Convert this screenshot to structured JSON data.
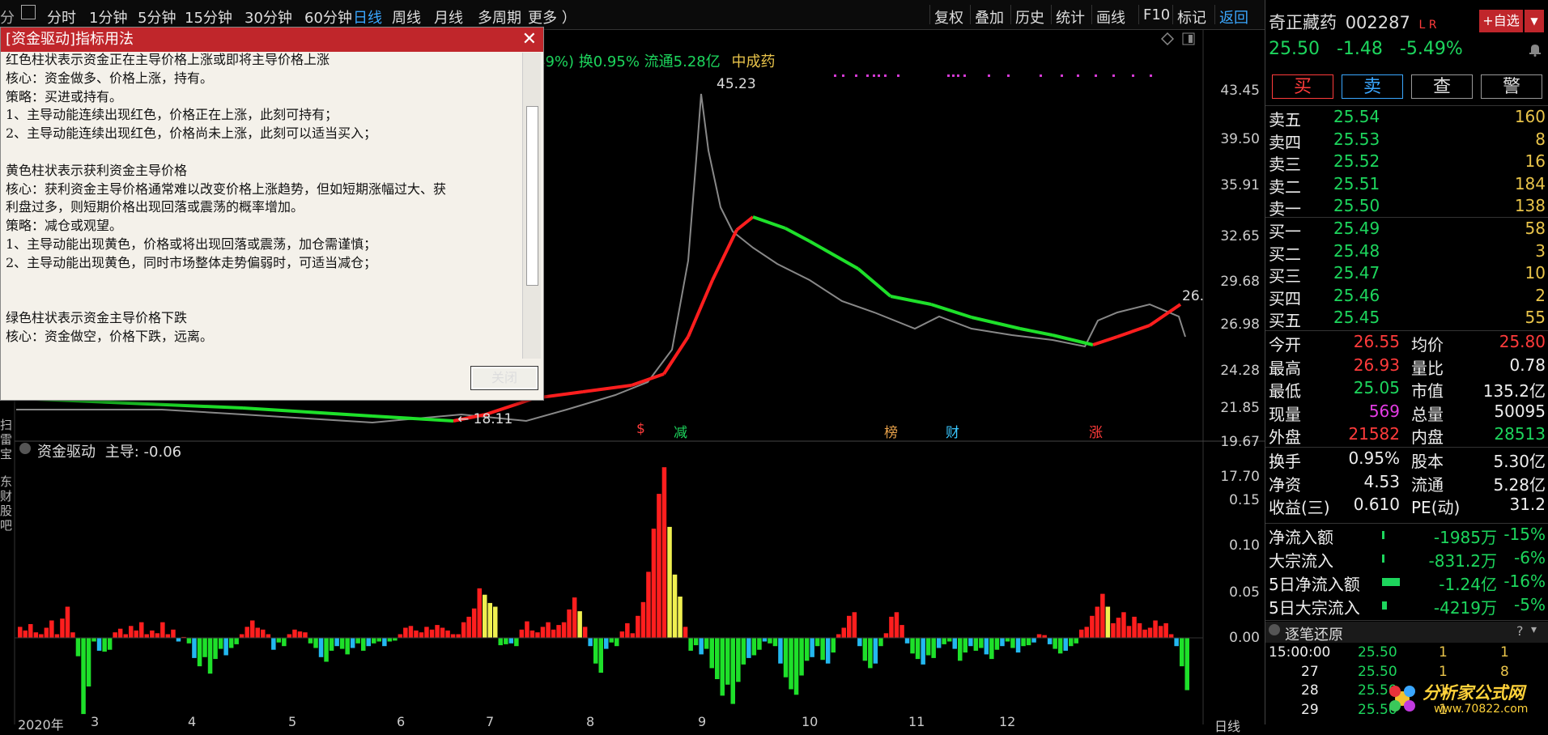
{
  "toolbar": {
    "left_stub": "分",
    "periods": [
      "分时",
      "1分钟",
      "5分钟",
      "15分钟",
      "30分钟",
      "60分钟",
      "日线",
      "周线",
      "月线",
      "多周期",
      "更多 ）"
    ],
    "active_period": "日线",
    "tools": [
      "复权",
      "叠加",
      "历史",
      "统计",
      "画线",
      "F10",
      "标记",
      "返回"
    ]
  },
  "main_chart": {
    "info_text": "49%) 换0.95% 流通5.28亿",
    "sector": "中成药",
    "price_axis": [
      "43.45",
      "39.50",
      "35.91",
      "32.65",
      "29.68",
      "26.98",
      "24.28",
      "21.85",
      "19.67",
      "17.70"
    ],
    "last_price_tag": "26.",
    "high_label": "45.23",
    "low_label": "← 18.11",
    "event_markers": [
      {
        "text": "$",
        "color": "#ff3b3b"
      },
      {
        "text": "减",
        "color": "#1dd65d"
      },
      {
        "text": "榜",
        "color": "#e9a24a"
      },
      {
        "text": "财",
        "color": "#3ac8ff"
      },
      {
        "text": "涨",
        "color": "#ff3b3b"
      }
    ]
  },
  "indicator": {
    "name": "资金驱动",
    "main_label": "主导: -0.06",
    "axis": [
      "0.15",
      "0.10",
      "0.05",
      "0.00"
    ],
    "x_axis": [
      "2020年",
      "3",
      "4",
      "5",
      "6",
      "7",
      "8",
      "9",
      "10",
      "11",
      "12"
    ],
    "period_label": "日线"
  },
  "left_vertical": {
    "text1": "扫雷宝",
    "text2": "东财股吧"
  },
  "dialog": {
    "title": "[资金驱动]指标用法",
    "lines": [
      "红色柱状表示资金正在主导价格上涨或即将主导价格上涨",
      "  核心：资金做多、价格上涨，持有。",
      "  策略：买进或持有。",
      "1、主导动能连续出现红色，价格正在上涨，此刻可持有；",
      "2、主导动能连续出现红色，价格尚未上涨，此刻可以适当买入；",
      "",
      "  黄色柱状表示获利资金主导价格",
      "  核心：获利资金主导价格通常难以改变价格上涨趋势，但如短期涨幅过大、获",
      "利盘过多，则短期价格出现回落或震荡的概率增加。",
      "  策略：减仓或观望。",
      "1、主导动能出现黄色，价格或将出现回落或震荡，加仓需谨慎；",
      "2、主导动能出现黄色，同时市场整体走势偏弱时，可适当减仓；",
      "",
      "",
      "  绿色柱状表示资金主导价格下跌",
      "  核心：资金做空，价格下跌，远离。"
    ],
    "close_label": "关闭"
  },
  "quote": {
    "name": "奇正藏药",
    "code": "002287",
    "flags": "L R",
    "add_watch": "+自选",
    "price": "25.50",
    "change": "-1.48",
    "change_pct": "-5.49%",
    "buttons": [
      "买",
      "卖",
      "查",
      "警"
    ],
    "asks": [
      {
        "label": "卖五",
        "price": "25.54",
        "vol": "160"
      },
      {
        "label": "卖四",
        "price": "25.53",
        "vol": "8"
      },
      {
        "label": "卖三",
        "price": "25.52",
        "vol": "16"
      },
      {
        "label": "卖二",
        "price": "25.51",
        "vol": "184"
      },
      {
        "label": "卖一",
        "price": "25.50",
        "vol": "138"
      }
    ],
    "bids": [
      {
        "label": "买一",
        "price": "25.49",
        "vol": "58"
      },
      {
        "label": "买二",
        "price": "25.48",
        "vol": "3"
      },
      {
        "label": "买三",
        "price": "25.47",
        "vol": "10"
      },
      {
        "label": "买四",
        "price": "25.46",
        "vol": "2"
      },
      {
        "label": "买五",
        "price": "25.45",
        "vol": "55"
      }
    ],
    "stats": [
      {
        "k1": "今开",
        "v1": "26.55",
        "k2": "均价",
        "v2": "25.80"
      },
      {
        "k1": "最高",
        "v1": "26.93",
        "k2": "量比",
        "v2": "0.78"
      },
      {
        "k1": "最低",
        "v1": "25.05",
        "k2": "市值",
        "v2": "135.2亿"
      },
      {
        "k1": "现量",
        "v1": "569",
        "k2": "总量",
        "v2": "50095"
      },
      {
        "k1": "外盘",
        "v1": "21582",
        "k2": "内盘",
        "v2": "28513"
      }
    ],
    "stats2": [
      {
        "k1": "换手",
        "v1": "0.95%",
        "k2": "股本",
        "v2": "5.30亿"
      },
      {
        "k1": "净资",
        "v1": "4.53",
        "k2": "流通",
        "v2": "5.28亿"
      },
      {
        "k1": "收益(三)",
        "v1": "0.610",
        "k2": "PE(动)",
        "v2": "31.2"
      }
    ],
    "flows": [
      {
        "label": "净流入额",
        "value": "-1985万",
        "pct": "-15%"
      },
      {
        "label": "大宗流入",
        "value": "-831.2万",
        "pct": "-6%"
      },
      {
        "label": "5日净流入额",
        "value": "-1.24亿",
        "pct": "-16%"
      },
      {
        "label": "5日大宗流入",
        "value": "-4219万",
        "pct": "-5%"
      }
    ],
    "tick_title": "逐笔还原",
    "ticks": [
      {
        "time": "15:00:00",
        "price": "25.50",
        "a": "1",
        "b": "1"
      },
      {
        "time": "27",
        "price": "25.50",
        "a": "1",
        "b": "8"
      },
      {
        "time": "28",
        "price": "25.50",
        "a": "1",
        "b": ""
      },
      {
        "time": "29",
        "price": "25.50",
        "a": "1",
        "b": ""
      }
    ],
    "watermark": "分析家公式网",
    "watermark_url": "www.70822.com"
  },
  "chart_data": {
    "type": "bar",
    "title": "资金驱动",
    "ylim": [
      -0.09,
      0.19
    ],
    "series": [
      {
        "name": "主导",
        "values": [
          0.012,
          0.008,
          0.015,
          0.006,
          0.004,
          0.011,
          0.019,
          0.004,
          0.021,
          0.034,
          0.006,
          -0.02,
          -0.083,
          -0.053,
          -0.004,
          -0.014,
          -0.015,
          -0.013,
          0.006,
          0.01,
          0.004,
          0.013,
          0.008,
          0.017,
          0.004,
          0.008,
          0.005,
          0.017,
          0.004,
          0.009,
          -0.004,
          0.001,
          -0.006,
          -0.022,
          -0.031,
          -0.021,
          -0.039,
          -0.023,
          -0.012,
          -0.019,
          -0.011,
          -0.007,
          0.004,
          0.012,
          0.019,
          0.011,
          0.009,
          0.004,
          -0.013,
          -0.005,
          -0.009,
          0.004,
          0.009,
          0.007,
          0.006,
          -0.006,
          -0.011,
          -0.021,
          -0.026,
          -0.014,
          -0.009,
          -0.012,
          -0.018,
          -0.011,
          -0.006,
          -0.014,
          -0.009,
          -0.006,
          -0.004,
          -0.009,
          -0.004,
          -0.003,
          0.004,
          0.011,
          0.013,
          0.008,
          0.006,
          0.012,
          0.009,
          0.014,
          0.011,
          0.008,
          0.004,
          0.004,
          0.017,
          0.023,
          0.032,
          0.054,
          0.047,
          0.038,
          0.034,
          -0.008,
          -0.007,
          -0.006,
          -0.009,
          0.009,
          0.018,
          0.008,
          0.006,
          0.012,
          0.017,
          0.009,
          0.014,
          0.017,
          0.031,
          0.044,
          0.029,
          0.012,
          -0.009,
          -0.028,
          -0.038,
          -0.012,
          -0.005,
          -0.009,
          0.007,
          0.016,
          0.005,
          0.024,
          0.039,
          0.072,
          0.119,
          0.157,
          0.186,
          0.121,
          0.069,
          0.045,
          0.012,
          -0.014,
          -0.008,
          -0.018,
          -0.012,
          -0.033,
          -0.045,
          -0.063,
          -0.051,
          -0.072,
          -0.048,
          -0.029,
          -0.022,
          -0.019,
          -0.013,
          -0.004,
          -0.006,
          -0.009,
          -0.028,
          -0.043,
          -0.056,
          -0.062,
          -0.041,
          -0.025,
          -0.021,
          -0.009,
          -0.024,
          -0.028,
          -0.016,
          0.004,
          0.011,
          0.024,
          0.028,
          -0.009,
          -0.025,
          -0.033,
          -0.028,
          -0.009,
          0.005,
          0.023,
          0.028,
          0.014,
          -0.006,
          -0.017,
          -0.023,
          -0.029,
          -0.019,
          -0.022,
          -0.011,
          -0.007,
          -0.004,
          -0.012,
          -0.025,
          -0.016,
          -0.009,
          -0.014,
          -0.011,
          -0.018,
          -0.023,
          -0.013,
          -0.009,
          -0.004,
          -0.011,
          -0.016,
          -0.009,
          -0.008,
          -0.005,
          0.004,
          0.003,
          -0.007,
          -0.012,
          -0.017,
          -0.014,
          -0.009,
          -0.006,
          0.009,
          0.012,
          0.024,
          0.034,
          0.048,
          0.034,
          0.016,
          0.022,
          0.028,
          0.013,
          0.023,
          0.016,
          0.009,
          0.011,
          0.019,
          0.013,
          0.016,
          0.004,
          -0.009,
          -0.031,
          -0.057
        ]
      }
    ],
    "colors": {
      "up": "#ff1e1e",
      "profit": "#f0f050",
      "down": "#1ee02a",
      "weak_down": "#23b8f0"
    }
  }
}
